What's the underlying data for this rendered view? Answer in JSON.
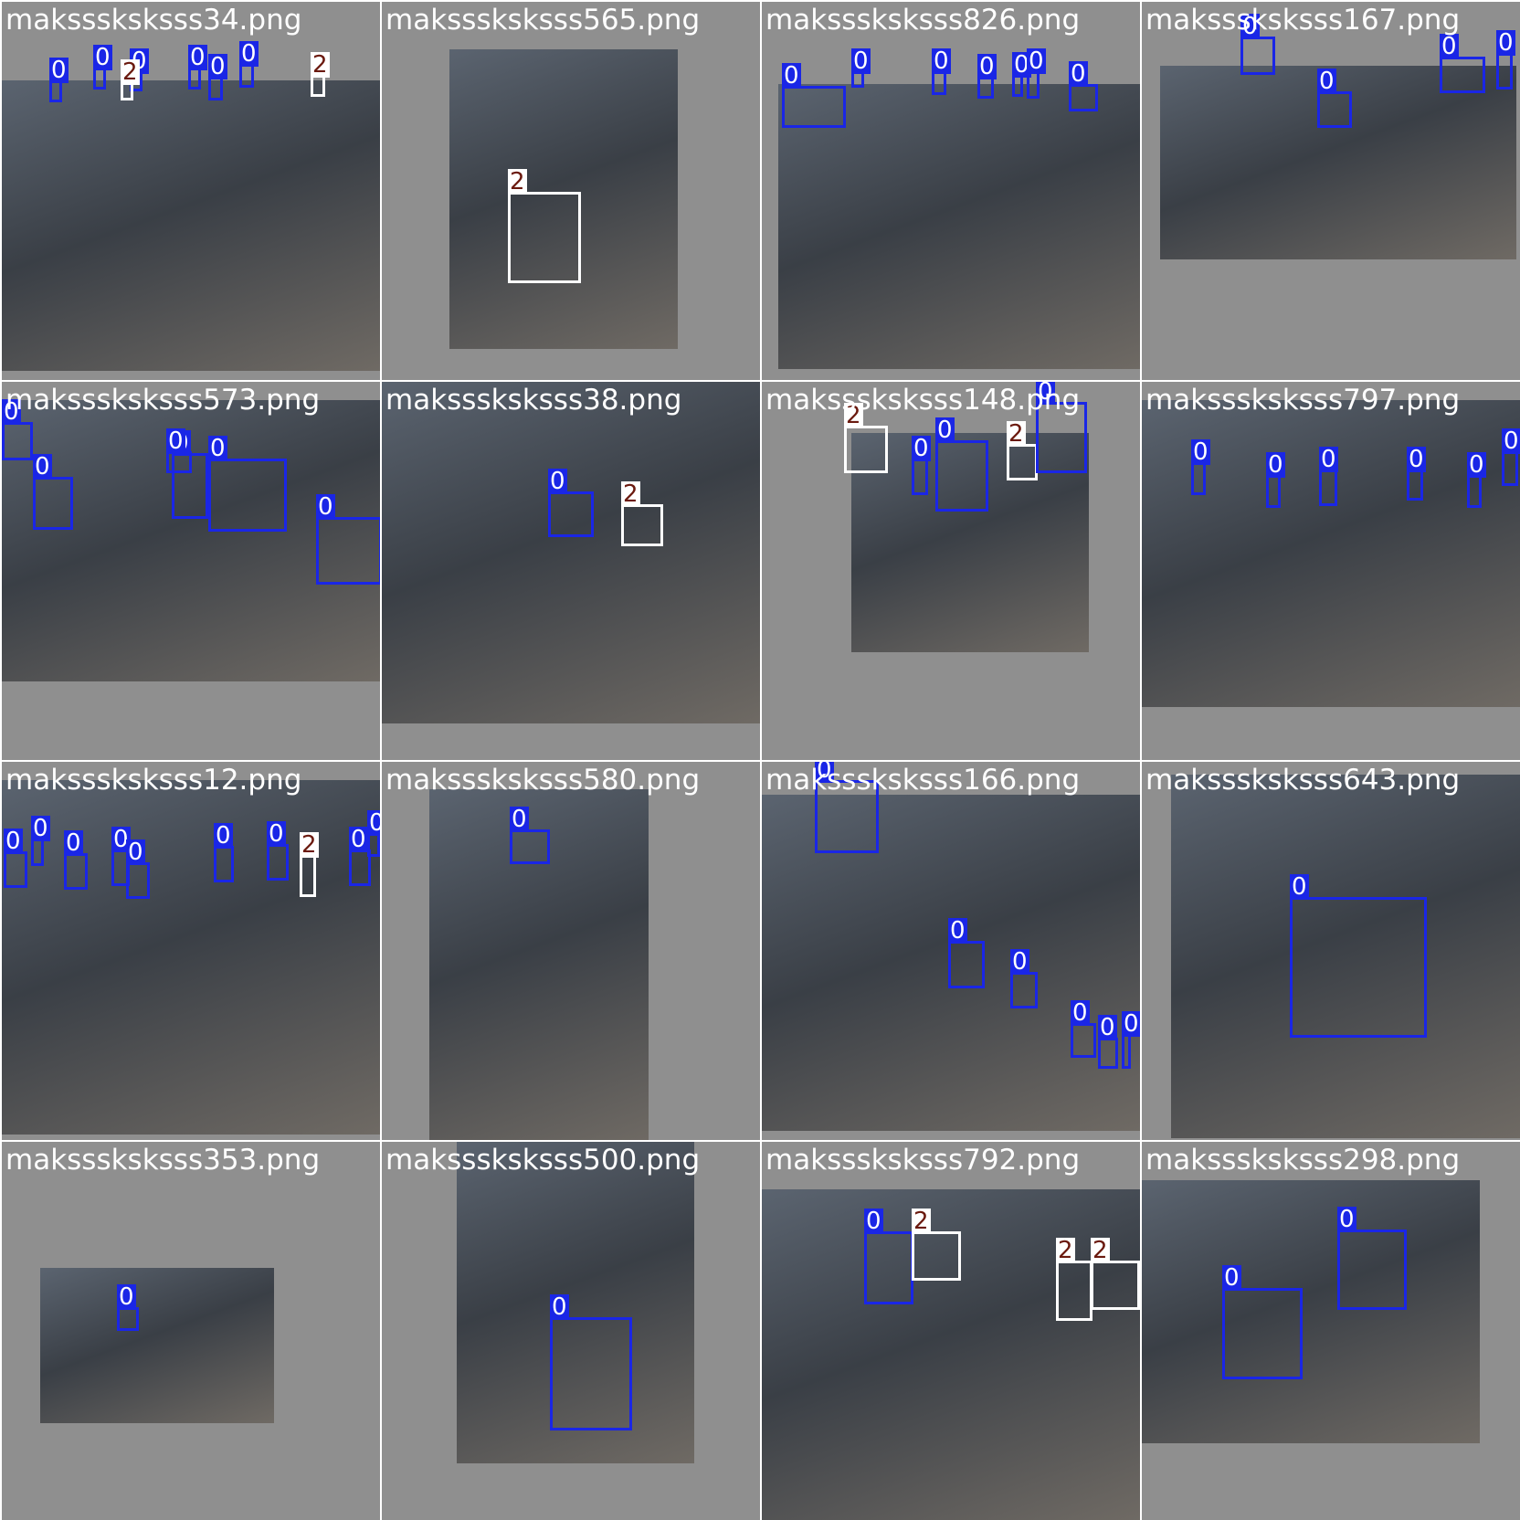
{
  "tiles": [
    {
      "filename": "maksssksksss34.png",
      "labels": [
        "0",
        "0",
        "0",
        "0",
        "0",
        "0",
        "2",
        "2"
      ]
    },
    {
      "filename": "maksssksksss565.png",
      "labels": [
        "2"
      ]
    },
    {
      "filename": "maksssksksss826.png",
      "labels": [
        "0",
        "0",
        "0",
        "0",
        "0",
        "0",
        "0"
      ]
    },
    {
      "filename": "maksssksksss167.png",
      "labels": [
        "0",
        "0",
        "0",
        "0"
      ]
    },
    {
      "filename": "maksssksksss573.png",
      "labels": [
        "0",
        "0",
        "0",
        "0",
        "0",
        "0"
      ]
    },
    {
      "filename": "maksssksksss38.png",
      "labels": [
        "0",
        "2"
      ]
    },
    {
      "filename": "maksssksksss148.png",
      "labels": [
        "2",
        "0",
        "0",
        "2",
        "0"
      ]
    },
    {
      "filename": "maksssksksss797.png",
      "labels": [
        "0",
        "0",
        "0",
        "0",
        "0",
        "0"
      ]
    },
    {
      "filename": "maksssksksss12.png",
      "labels": [
        "0",
        "0",
        "0",
        "0",
        "0",
        "0",
        "0",
        "2",
        "0",
        "0"
      ]
    },
    {
      "filename": "maksssksksss580.png",
      "labels": [
        "0"
      ]
    },
    {
      "filename": "maksssksksss166.png",
      "labels": [
        "0",
        "0",
        "0",
        "0",
        "0",
        "0"
      ]
    },
    {
      "filename": "maksssksksss643.png",
      "labels": [
        "0"
      ]
    },
    {
      "filename": "maksssksksss353.png",
      "labels": [
        "0"
      ]
    },
    {
      "filename": "maksssksksss500.png",
      "labels": [
        "0"
      ]
    },
    {
      "filename": "maksssksksss792.png",
      "labels": [
        "0",
        "2",
        "2",
        "2"
      ]
    },
    {
      "filename": "maksssksksss298.png",
      "labels": [
        "0",
        "0"
      ]
    }
  ],
  "class_colors": {
    "0": "#1a26e6",
    "2": "#ffffff"
  }
}
